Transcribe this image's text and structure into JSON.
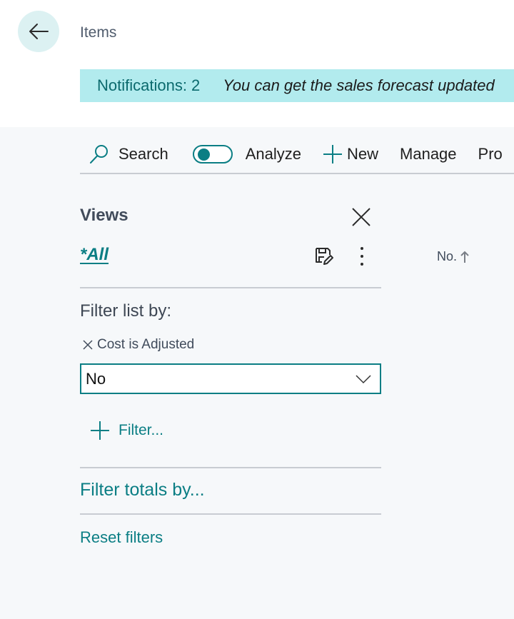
{
  "header": {
    "back_icon": "arrow-left-icon",
    "title": "Items",
    "notification_count": "Notifications: 2",
    "notification_message": "You can get the sales forecast updated"
  },
  "actionbar": {
    "search_icon": "search-icon",
    "search_label": "Search",
    "analyze_toggle_on": false,
    "analyze_label": "Analyze",
    "new_icon": "plus-icon",
    "new_label": "New",
    "manage_label": "Manage",
    "truncated_label": "Pro"
  },
  "views": {
    "title": "Views",
    "close_icon": "close-icon",
    "current_view": "*All",
    "save_view_icon": "save-edit-icon",
    "more_icon": "more-vertical-icon"
  },
  "list": {
    "column_header": "No.",
    "sort_icon": "arrow-up-icon"
  },
  "filters": {
    "filter_list_label": "Filter list by:",
    "field_name": "Cost is Adjusted",
    "field_value": "No",
    "dropdown_icon": "chevron-down-icon",
    "add_filter_label": "Filter...",
    "filter_totals_label": "Filter totals by...",
    "reset_label": "Reset filters"
  },
  "colors": {
    "accent": "#0b7e84",
    "notification_bg": "#b2ebee",
    "back_button_bg": "#dcf1f2",
    "content_bg": "#f6f8fa"
  }
}
